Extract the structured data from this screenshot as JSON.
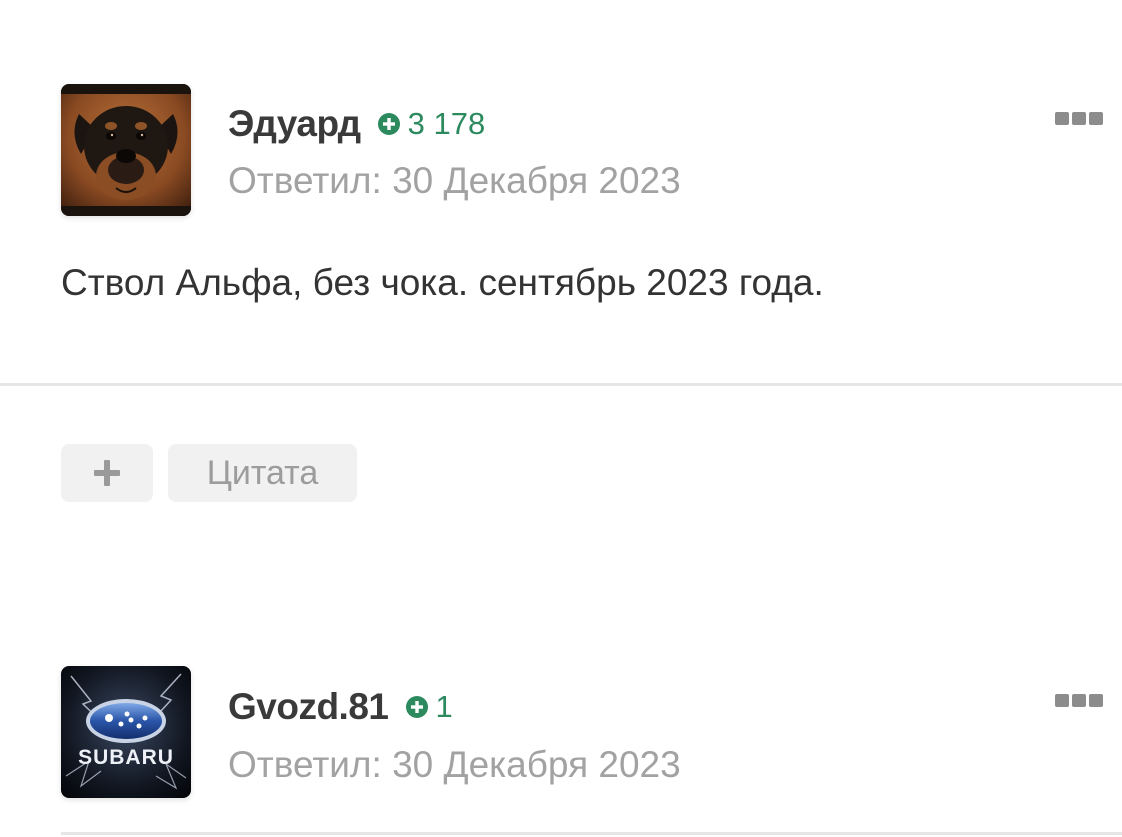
{
  "posts": [
    {
      "author": "Эдуард",
      "reputation": "3 178",
      "date": "Ответил: 30 Декабря 2023",
      "body": "Ствол Альфа, без чока. сентябрь 2023 года.",
      "avatar_icon": "rottweiler-avatar"
    },
    {
      "author": "Gvozd.81",
      "reputation": "1",
      "date": "Ответил: 30 Декабря 2023",
      "avatar_icon": "subaru-avatar"
    }
  ],
  "actions": {
    "plus_icon": "plus-icon",
    "quote_label": "Цитата"
  },
  "colors": {
    "reputation": "#2d8a5f",
    "author": "#3a3a3a",
    "muted": "#a2a2a2",
    "button_bg": "#f1f1f1"
  }
}
